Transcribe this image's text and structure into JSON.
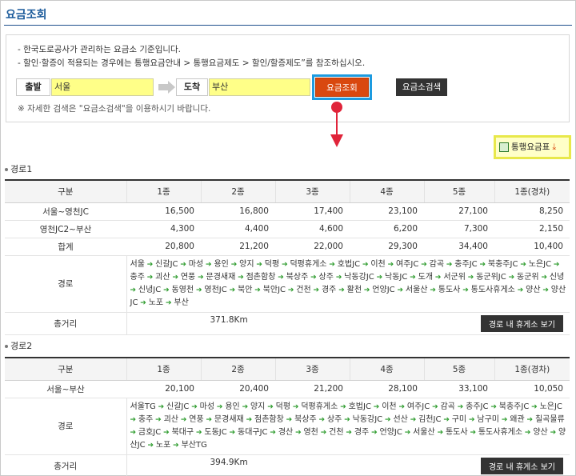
{
  "page": {
    "title": "요금조회"
  },
  "search": {
    "notes": [
      "- 한국도로공사가 관리하는 요금소 기준입니다.",
      "- 할인·할증이 적용되는 경우에는 통행요금안내 > 통행요금제도 > 할인/할증제도”를 참조하십시오."
    ],
    "origin_label": "출발",
    "origin_value": "서울",
    "dest_label": "도착",
    "dest_value": "부산",
    "fee_button": "요금조회",
    "search_button": "요금소검색",
    "note": "※ 자세한 검색은 \"요금소검색\"을 이용하시기 바랍니다."
  },
  "download": {
    "label": "통행요금표",
    "icon": "spreadsheet-icon",
    "arrow_icon": "download-icon"
  },
  "colors": {
    "accent": "#d9480f",
    "highlight_border": "#1d9be0",
    "input_bg": "#ffff88",
    "route_arrow": "#2a9a2a",
    "pointer": "#e0243a"
  },
  "routes": [
    {
      "title": "경로1",
      "headers": [
        "구분",
        "1종",
        "2종",
        "3종",
        "4종",
        "5종",
        "1종(경차)"
      ],
      "rows": [
        {
          "label": "서울~영천JC",
          "values": [
            "16,500",
            "16,800",
            "17,400",
            "23,100",
            "27,100",
            "8,250"
          ]
        },
        {
          "label": "영천JC2~부산",
          "values": [
            "4,300",
            "4,400",
            "4,600",
            "6,200",
            "7,300",
            "2,150"
          ]
        },
        {
          "label": "합계",
          "values": [
            "20,800",
            "21,200",
            "22,000",
            "29,300",
            "34,400",
            "10,400"
          ]
        }
      ],
      "path_label": "경로",
      "path": [
        "서울",
        "신갈JC",
        "마성",
        "용인",
        "양지",
        "덕평",
        "덕평휴게소",
        "호법JC",
        "이천",
        "여주JC",
        "감곡",
        "충주JC",
        "북충주JC",
        "노은JC",
        "충주",
        "괴산",
        "연풍",
        "문경새재",
        "점촌함창",
        "북상주",
        "상주",
        "낙동강JC",
        "낙동JC",
        "도개",
        "서군위",
        "동군위JC",
        "동군위",
        "신녕",
        "신녕JC",
        "동영천",
        "영천JC",
        "북안",
        "북안JC",
        "건천",
        "경주",
        "활천",
        "언양JC",
        "서울산",
        "통도사",
        "통도사휴게소",
        "양산",
        "양산JC",
        "노포",
        "부산"
      ],
      "distance_label": "총거리",
      "distance": "371.8Km",
      "rest_button": "경로 내 휴게소 보기"
    },
    {
      "title": "경로2",
      "headers": [
        "구분",
        "1종",
        "2종",
        "3종",
        "4종",
        "5종",
        "1종(경차)"
      ],
      "rows": [
        {
          "label": "서울~부산",
          "values": [
            "20,100",
            "20,400",
            "21,200",
            "28,100",
            "33,100",
            "10,050"
          ]
        }
      ],
      "path_label": "경로",
      "path": [
        "서울TG",
        "신갈JC",
        "마성",
        "용인",
        "양지",
        "덕평",
        "덕평휴게소",
        "호법JC",
        "이천",
        "여주JC",
        "감곡",
        "충주JC",
        "북충주JC",
        "노은JC",
        "충주",
        "괴산",
        "연풍",
        "문경새재",
        "점촌함창",
        "북상주",
        "상주",
        "낙동강JC",
        "선산",
        "김천JC",
        "구미",
        "남구미",
        "왜관",
        "칠곡물류",
        "금호JC",
        "북대구",
        "도동JC",
        "동대구JC",
        "경산",
        "영천",
        "건천",
        "경주",
        "언양JC",
        "서울산",
        "통도사",
        "통도사휴게소",
        "양산",
        "양산JC",
        "노포",
        "부산TG"
      ],
      "distance_label": "총거리",
      "distance": "394.9Km",
      "rest_button": "경로 내 휴게소 보기"
    }
  ]
}
